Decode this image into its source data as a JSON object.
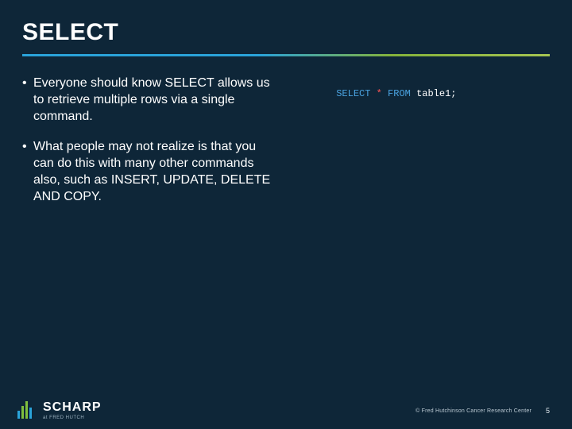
{
  "title": "SELECT",
  "bullets": [
    "Everyone should know SELECT allows us to retrieve multiple rows via a single command.",
    "What people may not realize is that you can do this with many other commands also, such as INSERT, UPDATE, DELETE AND COPY."
  ],
  "code": {
    "select": "SELECT",
    "star": "*",
    "from": "FROM",
    "table": "table1",
    "semi": ";"
  },
  "logo": {
    "name": "SCHARP",
    "subtitle": "at FRED HUTCH"
  },
  "footer": {
    "copyright": "© Fred Hutchinson Cancer Research Center",
    "page": "5"
  }
}
